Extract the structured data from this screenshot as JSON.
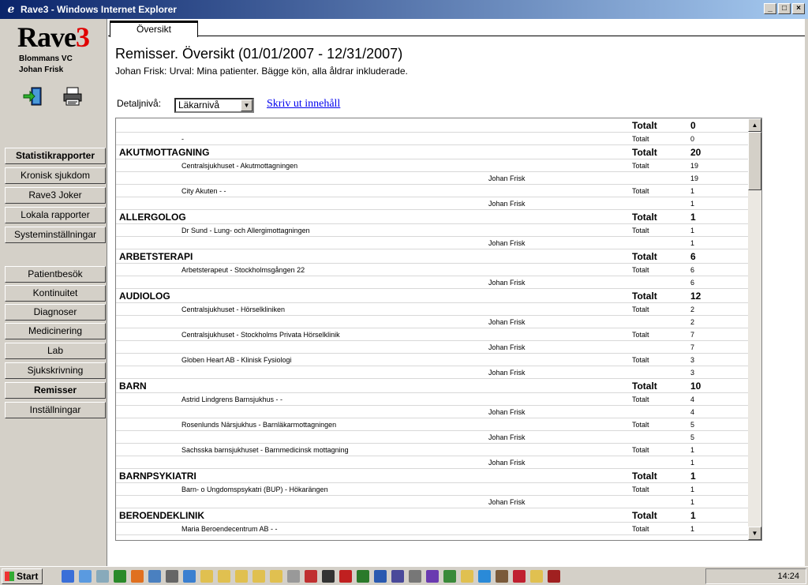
{
  "window": {
    "title": "Rave3 - Windows Internet Explorer"
  },
  "brand": {
    "name_main": "Rave",
    "name_num": "3",
    "clinic": "Blommans VC",
    "user": "Johan Frisk"
  },
  "sidebar": {
    "top_items": [
      {
        "label": "Statistikrapporter",
        "bold": true
      },
      {
        "label": "Kronisk sjukdom"
      },
      {
        "label": "Rave3 Joker"
      },
      {
        "label": "Lokala rapporter"
      },
      {
        "label": "Systeminställningar"
      }
    ],
    "bottom_items": [
      {
        "label": "Patientbesök"
      },
      {
        "label": "Kontinuitet"
      },
      {
        "label": "Diagnoser"
      },
      {
        "label": "Medicinering"
      },
      {
        "label": "Lab"
      },
      {
        "label": "Sjukskrivning"
      },
      {
        "label": "Remisser",
        "bold": true
      },
      {
        "label": "Inställningar"
      }
    ]
  },
  "tabs": [
    {
      "label": "Översikt",
      "active": true
    }
  ],
  "page": {
    "title": "Remisser. Översikt (01/01/2007 - 12/31/2007)",
    "subtitle": "Johan Frisk: Urval: Mina patienter. Bägge kön, alla åldrar inkluderade.",
    "detail_label": "Detaljnivå:",
    "detail_value": "Läkarnivå",
    "print_link": "Skriv ut innehåll"
  },
  "table": {
    "total_label": "Totalt",
    "rows": [
      {
        "type": "cat",
        "name": "",
        "value": "0"
      },
      {
        "type": "sub",
        "name": "-",
        "value": "0"
      },
      {
        "type": "cat",
        "name": "AKUTMOTTAGNING",
        "value": "20"
      },
      {
        "type": "sub",
        "name": "Centralsjukhuset - Akutmottagningen",
        "value": "19"
      },
      {
        "type": "doc",
        "name": "Johan Frisk",
        "value": "19"
      },
      {
        "type": "sub",
        "name": "City Akuten - -",
        "value": "1"
      },
      {
        "type": "doc",
        "name": "Johan Frisk",
        "value": "1"
      },
      {
        "type": "cat",
        "name": "ALLERGOLOG",
        "value": "1"
      },
      {
        "type": "sub",
        "name": "Dr Sund - Lung- och Allergimottagningen",
        "value": "1"
      },
      {
        "type": "doc",
        "name": "Johan Frisk",
        "value": "1"
      },
      {
        "type": "cat",
        "name": "ARBETSTERAPI",
        "value": "6"
      },
      {
        "type": "sub",
        "name": "Arbetsterapeut - Stockholmsgången 22",
        "value": "6"
      },
      {
        "type": "doc",
        "name": "Johan Frisk",
        "value": "6"
      },
      {
        "type": "cat",
        "name": "AUDIOLOG",
        "value": "12"
      },
      {
        "type": "sub",
        "name": "Centralsjukhuset - Hörselkliniken",
        "value": "2"
      },
      {
        "type": "doc",
        "name": "Johan Frisk",
        "value": "2"
      },
      {
        "type": "sub",
        "name": "Centralsjukhuset - Stockholms Privata Hörselklinik",
        "value": "7"
      },
      {
        "type": "doc",
        "name": "Johan Frisk",
        "value": "7"
      },
      {
        "type": "sub",
        "name": "Globen Heart AB - Klinisk Fysiologi",
        "value": "3"
      },
      {
        "type": "doc",
        "name": "Johan Frisk",
        "value": "3"
      },
      {
        "type": "cat",
        "name": "BARN",
        "value": "10"
      },
      {
        "type": "sub",
        "name": "Astrid Lindgrens Barnsjukhus - -",
        "value": "4"
      },
      {
        "type": "doc",
        "name": "Johan Frisk",
        "value": "4"
      },
      {
        "type": "sub",
        "name": "Rosenlunds Närsjukhus - Barnläkarmottagningen",
        "value": "5"
      },
      {
        "type": "doc",
        "name": "Johan Frisk",
        "value": "5"
      },
      {
        "type": "sub",
        "name": "Sachsska barnsjukhuset - Barnmedicinsk mottagning",
        "value": "1"
      },
      {
        "type": "doc",
        "name": "Johan Frisk",
        "value": "1"
      },
      {
        "type": "cat",
        "name": "BARNPSYKIATRI",
        "value": "1"
      },
      {
        "type": "sub",
        "name": "Barn- o Ungdomspsykatri (BUP) - Hökarängen",
        "value": "1"
      },
      {
        "type": "doc",
        "name": "Johan Frisk",
        "value": "1"
      },
      {
        "type": "cat",
        "name": "BEROENDEKLINIK",
        "value": "1"
      },
      {
        "type": "sub",
        "name": "Maria Beroendecentrum AB - -",
        "value": "1"
      }
    ]
  },
  "taskbar": {
    "start_label": "Start",
    "clock": "14:24"
  }
}
